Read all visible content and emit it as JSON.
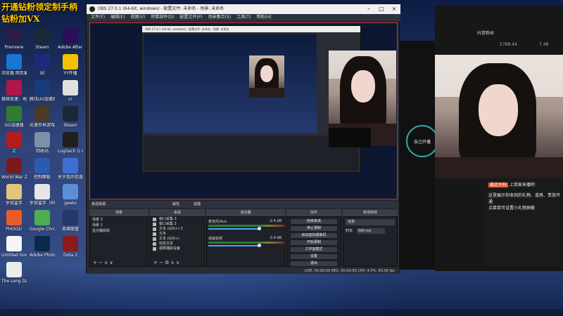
{
  "banner": {
    "line1": "开通钻粉领定制手柄",
    "line2": "钻粉加VX"
  },
  "desktop_icons": [
    {
      "label": "Premiere",
      "color": "#2a1d4a"
    },
    {
      "label": "Steam\n_win_x64_v...",
      "color": "#1b2838"
    },
    {
      "label": "Adobe After Effects 2020",
      "color": "#2a0f59"
    },
    {
      "label": "浏览器 网页编辑器",
      "color": "#1976d2"
    },
    {
      "label": "SE",
      "color": "#1c2a7a"
    },
    {
      "label": "YY开播",
      "color": "#f2c200"
    },
    {
      "label": "极限竞速：地平线5",
      "color": "#b0164b"
    },
    {
      "label": "腾讯UU加速器",
      "color": "#173d7a"
    },
    {
      "label": "cr",
      "color": "#e0e0e0"
    },
    {
      "label": "GG加速器",
      "color": "#2e7d32"
    },
    {
      "label": "光速世界游戏平台",
      "color": "#4a3a26"
    },
    {
      "label": "Steam\n_win_x64_v...",
      "color": "#1b2838"
    },
    {
      "label": "Z",
      "color": "#b71c1c"
    },
    {
      "label": "回收站",
      "color": "#7f8fa6"
    },
    {
      "label": "Logitech G HUB",
      "color": "#1f1f1f"
    },
    {
      "label": "World War Z Aftermath",
      "color": "#7a1a1a"
    },
    {
      "label": "控制面板",
      "color": "#2a5bb3"
    },
    {
      "label": "关于我的信息",
      "color": "#3d6fd3"
    },
    {
      "label": "罗技雷手",
      "color": "#e3c67a"
    },
    {
      "label": "罗技雷手（RME）",
      "color": "#e6e6e6"
    },
    {
      "label": "geeks",
      "color": "#5c8fd6"
    },
    {
      "label": "PHOGS!",
      "color": "#e85c2a"
    },
    {
      "label": "Google Chrome",
      "color": "#4caf50"
    },
    {
      "label": "英雄联盟",
      "color": "#233a66"
    },
    {
      "label": "Untitled Goos...",
      "color": "#f5f5f5"
    },
    {
      "label": "Adobe Photosh...",
      "color": "#0b2a4a"
    },
    {
      "label": "Dota 2",
      "color": "#8b1a1a"
    },
    {
      "label": "The Long Dark",
      "color": "#ececec"
    }
  ],
  "obs": {
    "title": "OBS 27.0.1 (64-bit, windows) - 配置文件: 未命名 - 场景: 未命名",
    "menu": [
      "文件(F)",
      "编辑(E)",
      "视图(V)",
      "停靠部件(D)",
      "配置文件(P)",
      "场景集合(S)",
      "工具(T)",
      "帮助(H)"
    ],
    "window_buttons": [
      "–",
      "□",
      "×"
    ],
    "context_bar": "来选择源",
    "context_buttons": [
      "属性",
      "滤镜"
    ],
    "docks": {
      "scenes": "场景",
      "sources": "来源",
      "mixer": "混音器",
      "transitions": "转场特效",
      "controls": "控件"
    },
    "scenes": [
      "场景 3",
      "场景 2",
      "显示器获取"
    ],
    "sources": [
      "窗口采集 3",
      "窗口采集 2",
      "文本 (GDI+) 3",
      "文本",
      "文本 (GDI+)",
      "动态文本",
      "视频捕获设备"
    ],
    "mixer": [
      {
        "name": "麦克风/Aux",
        "db": "-2.4 dB"
      },
      {
        "name": "桌面音频",
        "db": "-3.9 dB"
      }
    ],
    "transition": {
      "type": "淡变",
      "duration_label": "时长",
      "duration_value": "300 ms"
    },
    "controls": [
      "结束串流",
      "停止录制",
      "启动虚拟摄像机",
      "开始录制",
      "工作室模式",
      "设置",
      "退出"
    ],
    "status": "LIVE: 00:00:00   REC: 00:00:00   CPU: 4.0%, 60.00 fps"
  },
  "nested_obs_title": "OBS 27.0.1 (64-bit, windows) - 配置文件: 未命名 - 场景: 未命名",
  "stream_app": {
    "stats": [
      "5788.44",
      "7.48"
    ],
    "header": "抖音粉丝",
    "chat_lines": [
      {
        "text": "上我家来播吧",
        "badge": "暴走许科"
      },
      {
        "text": "这里展示你收到的礼物、道具、贵族开通"
      },
      {
        "text": "点菜单可设置小礼物屏蔽"
      }
    ],
    "start_btn": "自己开播"
  },
  "colors": {
    "obs_bg": "#272a33",
    "accent_red": "#c7303a",
    "slider_blue": "#4da3ff",
    "banner_yellow": "#ffcc00"
  }
}
